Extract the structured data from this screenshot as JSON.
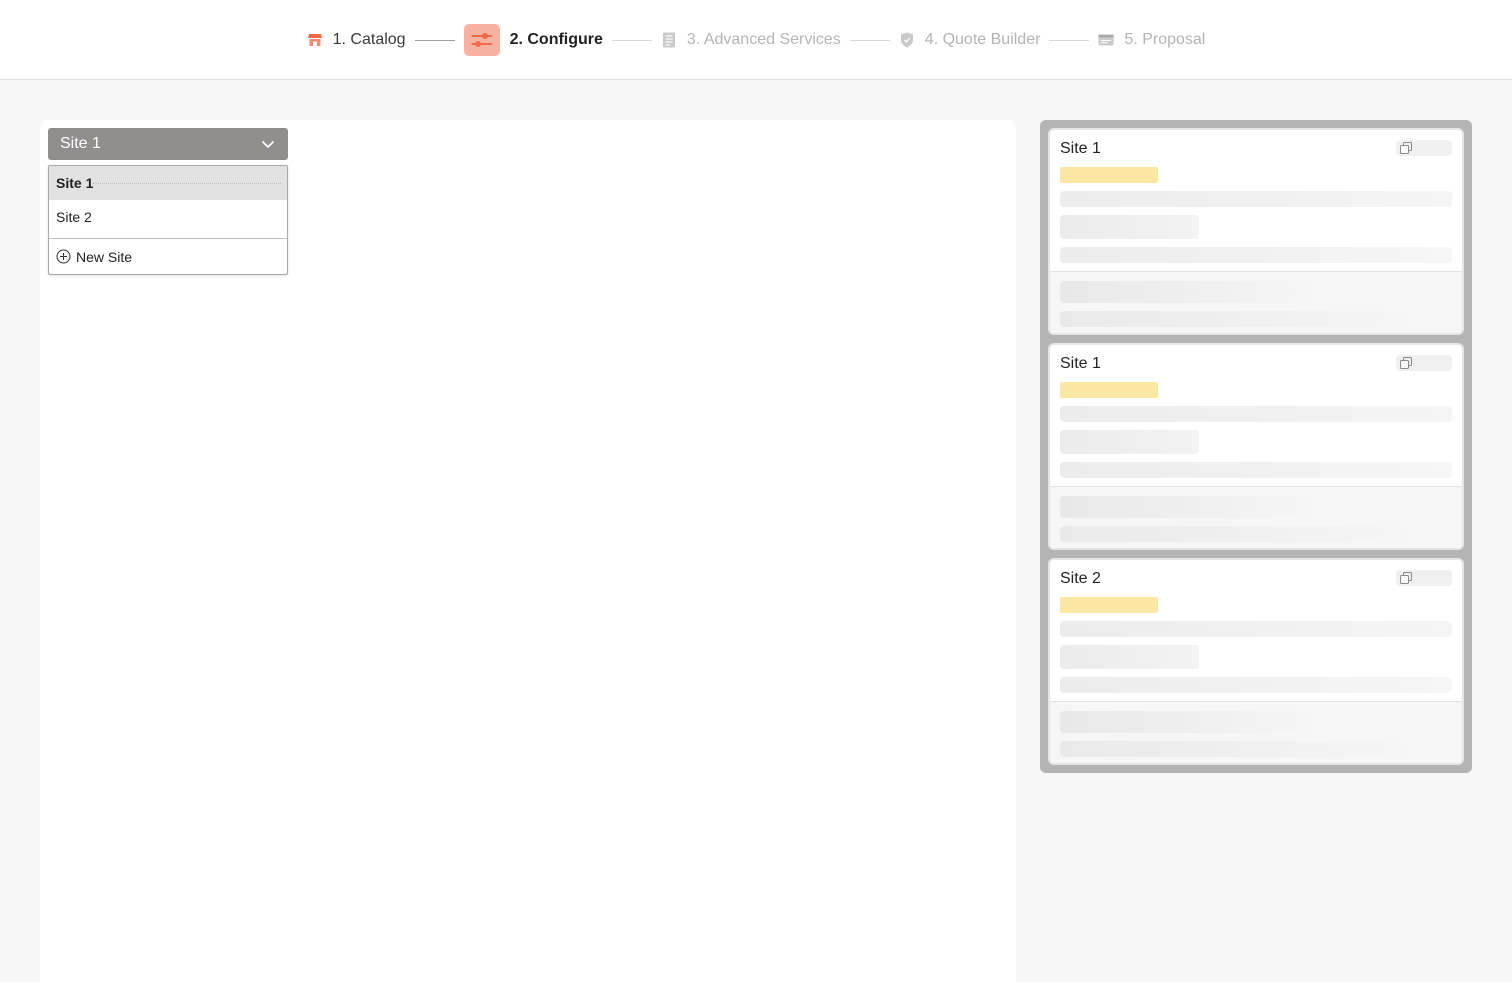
{
  "stepper": {
    "steps": [
      {
        "label": "1. Catalog",
        "state": "done",
        "icon": "storefront-icon"
      },
      {
        "label": "2. Configure",
        "state": "active",
        "icon": "sliders-icon"
      },
      {
        "label": "3. Advanced Services",
        "state": "upcoming",
        "icon": "document-list-icon"
      },
      {
        "label": "4. Quote Builder",
        "state": "upcoming",
        "icon": "shield-badge-icon"
      },
      {
        "label": "5. Proposal",
        "state": "upcoming",
        "icon": "envelope-icon"
      }
    ]
  },
  "site_select": {
    "value": "Site 1",
    "icon": "chevron-down-icon",
    "options": [
      "Site 1",
      "Site 2"
    ],
    "new_label": "New Site",
    "new_icon": "plus-circle-icon"
  },
  "summary": {
    "cards": [
      {
        "name": "Site 1"
      },
      {
        "name": "Site 1"
      },
      {
        "name": "Site 2"
      }
    ],
    "copy_icon": "copy-icon"
  },
  "colors": {
    "accent": "#f06a4a",
    "accent_bg": "#f5b2a1",
    "select_bg": "#928e8e",
    "highlight_bar": "#fce6a4"
  }
}
